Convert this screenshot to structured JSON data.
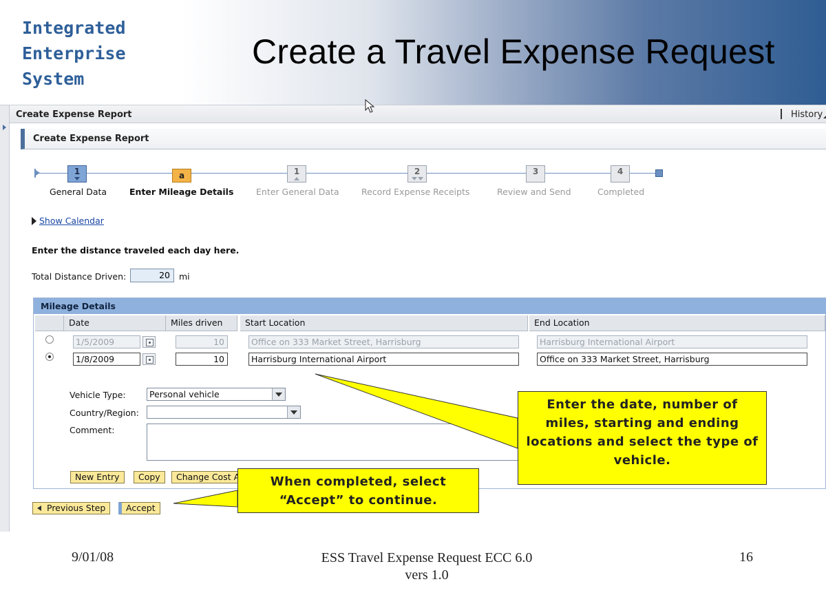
{
  "slide": {
    "logo_lines": [
      "Integrated",
      "Enterprise",
      "System"
    ],
    "title": "Create a Travel Expense Request"
  },
  "sap": {
    "window_title": "Create Expense Report",
    "history_label": "History",
    "page_title": "Create Expense Report",
    "roadmap": [
      {
        "number": "1",
        "label": "General Data",
        "state": "done"
      },
      {
        "number": "a",
        "label": "Enter Mileage Details",
        "state": "current"
      },
      {
        "number": "1",
        "label": "Enter General Data",
        "state": "pending"
      },
      {
        "number": "2",
        "label": "Record Expense Receipts",
        "state": "pending"
      },
      {
        "number": "3",
        "label": "Review and Send",
        "state": "pending"
      },
      {
        "number": "4",
        "label": "Completed",
        "state": "pending"
      }
    ],
    "show_calendar": "Show Calendar",
    "instruction": "Enter the distance traveled each day here.",
    "total_distance_label": "Total Distance Driven:",
    "total_distance_value": "20",
    "total_distance_unit": "mi",
    "mileage": {
      "title": "Mileage Details",
      "columns": [
        "Date",
        "Miles driven",
        "Start Location",
        "End Location"
      ],
      "rows": [
        {
          "selected": false,
          "date": "1/5/2009",
          "miles": "10",
          "start": "Office on 333 Market Street, Harrisburg",
          "end": "Harrisburg International Airport"
        },
        {
          "selected": true,
          "date": "1/8/2009",
          "miles": "10",
          "start": "Harrisburg International Airport",
          "end": "Office on 333 Market Street, Harrisburg"
        }
      ],
      "vehicle_type_label": "Vehicle Type:",
      "vehicle_type_value": "Personal vehicle",
      "country_label": "Country/Region:",
      "country_value": "",
      "comment_label": "Comment:",
      "buttons": {
        "new_entry": "New Entry",
        "copy": "Copy",
        "change_cost": "Change Cost A"
      }
    },
    "nav_buttons": {
      "previous": "Previous Step",
      "accept": "Accept"
    }
  },
  "callouts": {
    "details": "Enter the date, number of miles, starting and ending locations and select the type of vehicle.",
    "accept": "When completed, select “Accept” to continue."
  },
  "footer": {
    "date": "9/01/08",
    "center_line1": "ESS Travel Expense Request ECC 6.0",
    "center_line2": "vers 1.0",
    "page": "16"
  },
  "colors": {
    "brand_blue": "#2e5f99",
    "callout_yellow": "#ffff00",
    "section_header": "#8fb1dd",
    "button_yellow": "#fbe99a"
  }
}
